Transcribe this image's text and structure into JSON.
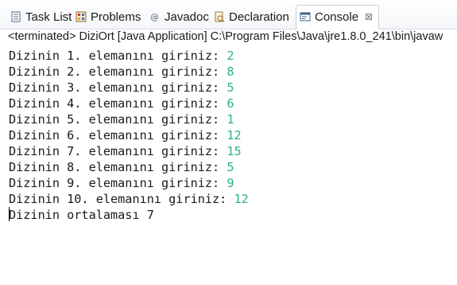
{
  "tabs": [
    {
      "label": "Task List",
      "icon": "task-list-icon"
    },
    {
      "label": "Problems",
      "icon": "problems-icon"
    },
    {
      "label": "Javadoc",
      "icon": "javadoc-icon"
    },
    {
      "label": "Declaration",
      "icon": "declaration-icon"
    },
    {
      "label": "Console",
      "icon": "console-icon",
      "close": "⊠"
    }
  ],
  "console_header": "<terminated> DiziOrt [Java Application] C:\\Program Files\\Java\\jre1.8.0_241\\bin\\javaw",
  "colors": {
    "input_text": "#2bb08a",
    "output_text": "#1a1a1a"
  },
  "console_lines": [
    {
      "prompt": "Dizinin 1. elemanını giriniz: ",
      "input": "2"
    },
    {
      "prompt": "Dizinin 2. elemanını giriniz: ",
      "input": "8"
    },
    {
      "prompt": "Dizinin 3. elemanını giriniz: ",
      "input": "5"
    },
    {
      "prompt": "Dizinin 4. elemanını giriniz: ",
      "input": "6"
    },
    {
      "prompt": "Dizinin 5. elemanını giriniz: ",
      "input": "1"
    },
    {
      "prompt": "Dizinin 6. elemanını giriniz: ",
      "input": "12"
    },
    {
      "prompt": "Dizinin 7. elemanını giriniz: ",
      "input": "15"
    },
    {
      "prompt": "Dizinin 8. elemanını giriniz: ",
      "input": "5"
    },
    {
      "prompt": "Dizinin 9. elemanını giriniz: ",
      "input": "9"
    },
    {
      "prompt": "Dizinin 10. elemanını giriniz: ",
      "input": "12"
    },
    {
      "prompt": "Dizinin ortalaması 7",
      "input": ""
    }
  ]
}
